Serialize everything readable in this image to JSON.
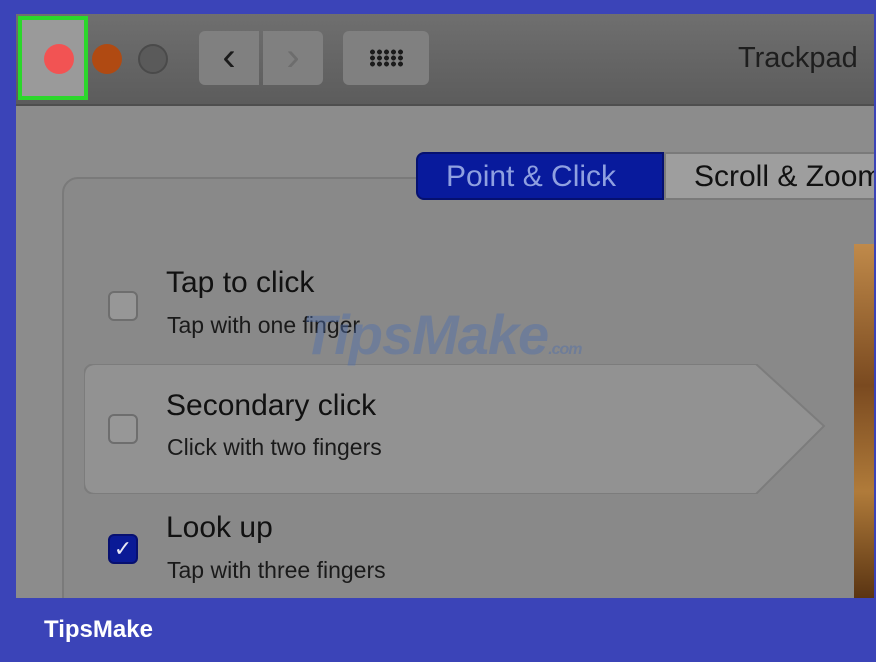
{
  "window": {
    "title": "Trackpad"
  },
  "toolbar": {
    "back_glyph": "‹",
    "forward_glyph": "›"
  },
  "tabs": [
    {
      "label": "Point & Click",
      "active": true
    },
    {
      "label": "Scroll & Zoom",
      "active": false
    }
  ],
  "options": [
    {
      "title": "Tap to click",
      "subtitle": "Tap with one finger",
      "checked": false
    },
    {
      "title": "Secondary click",
      "subtitle": "Click with two fingers",
      "checked": false
    },
    {
      "title": "Look up",
      "subtitle": "Tap with three fingers",
      "checked": true
    }
  ],
  "watermark": {
    "text": "TipsMake",
    "suffix": ".com"
  },
  "footer": {
    "brand": "TipsMake"
  },
  "colors": {
    "accent": "#081a9c",
    "frame": "#3b44b8",
    "highlight": "#2bd72b",
    "close": "#f25353"
  }
}
